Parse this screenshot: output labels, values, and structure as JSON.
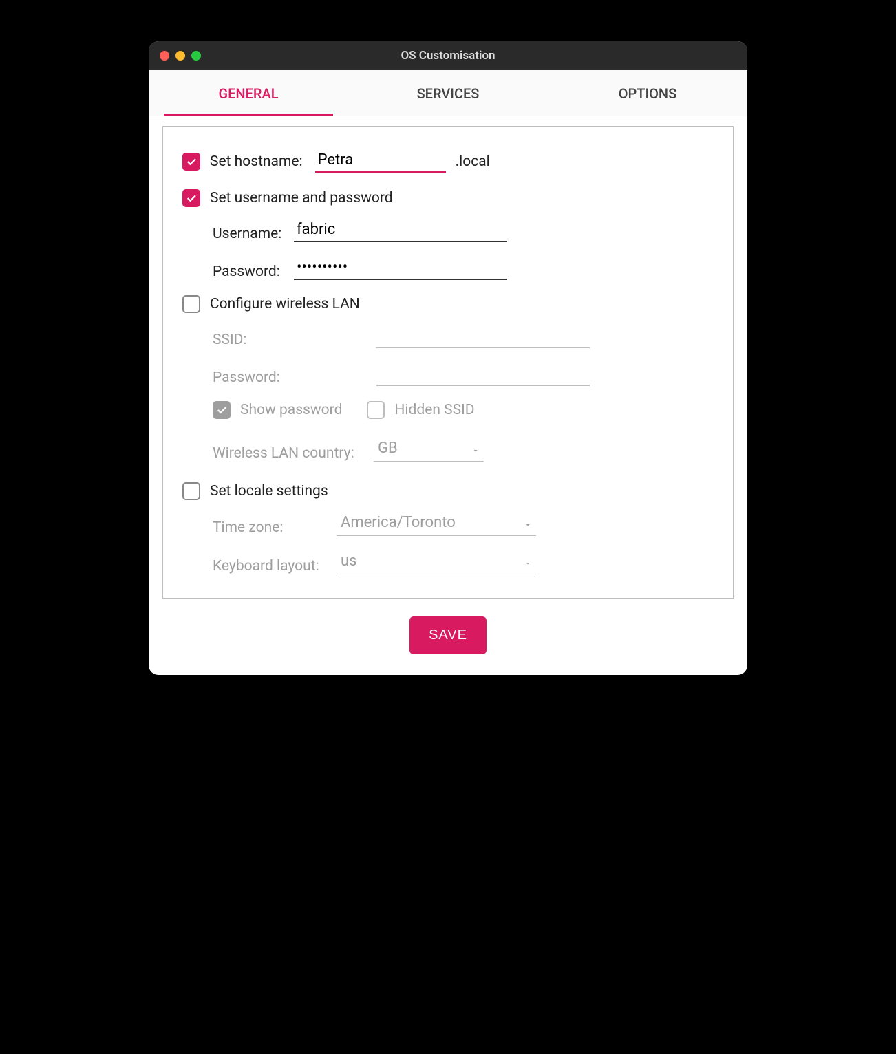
{
  "window": {
    "title": "OS Customisation"
  },
  "tabs": {
    "general": "GENERAL",
    "services": "SERVICES",
    "options": "OPTIONS",
    "active": "general"
  },
  "hostname": {
    "checkbox_label": "Set hostname:",
    "checked": true,
    "value": "Petra",
    "suffix": ".local"
  },
  "userpass": {
    "checkbox_label": "Set username and password",
    "checked": true,
    "username_label": "Username:",
    "username_value": "fabric",
    "password_label": "Password:",
    "password_value": "••••••••••"
  },
  "wifi": {
    "checkbox_label": "Configure wireless LAN",
    "checked": false,
    "ssid_label": "SSID:",
    "ssid_value": "",
    "password_label": "Password:",
    "password_value": "",
    "show_password_label": "Show password",
    "show_password_checked": true,
    "hidden_ssid_label": "Hidden SSID",
    "hidden_ssid_checked": false,
    "country_label": "Wireless LAN country:",
    "country_value": "GB"
  },
  "locale": {
    "checkbox_label": "Set locale settings",
    "checked": false,
    "timezone_label": "Time zone:",
    "timezone_value": "America/Toronto",
    "keyboard_label": "Keyboard layout:",
    "keyboard_value": "us"
  },
  "footer": {
    "save_label": "SAVE"
  },
  "colors": {
    "accent": "#d81b60"
  }
}
